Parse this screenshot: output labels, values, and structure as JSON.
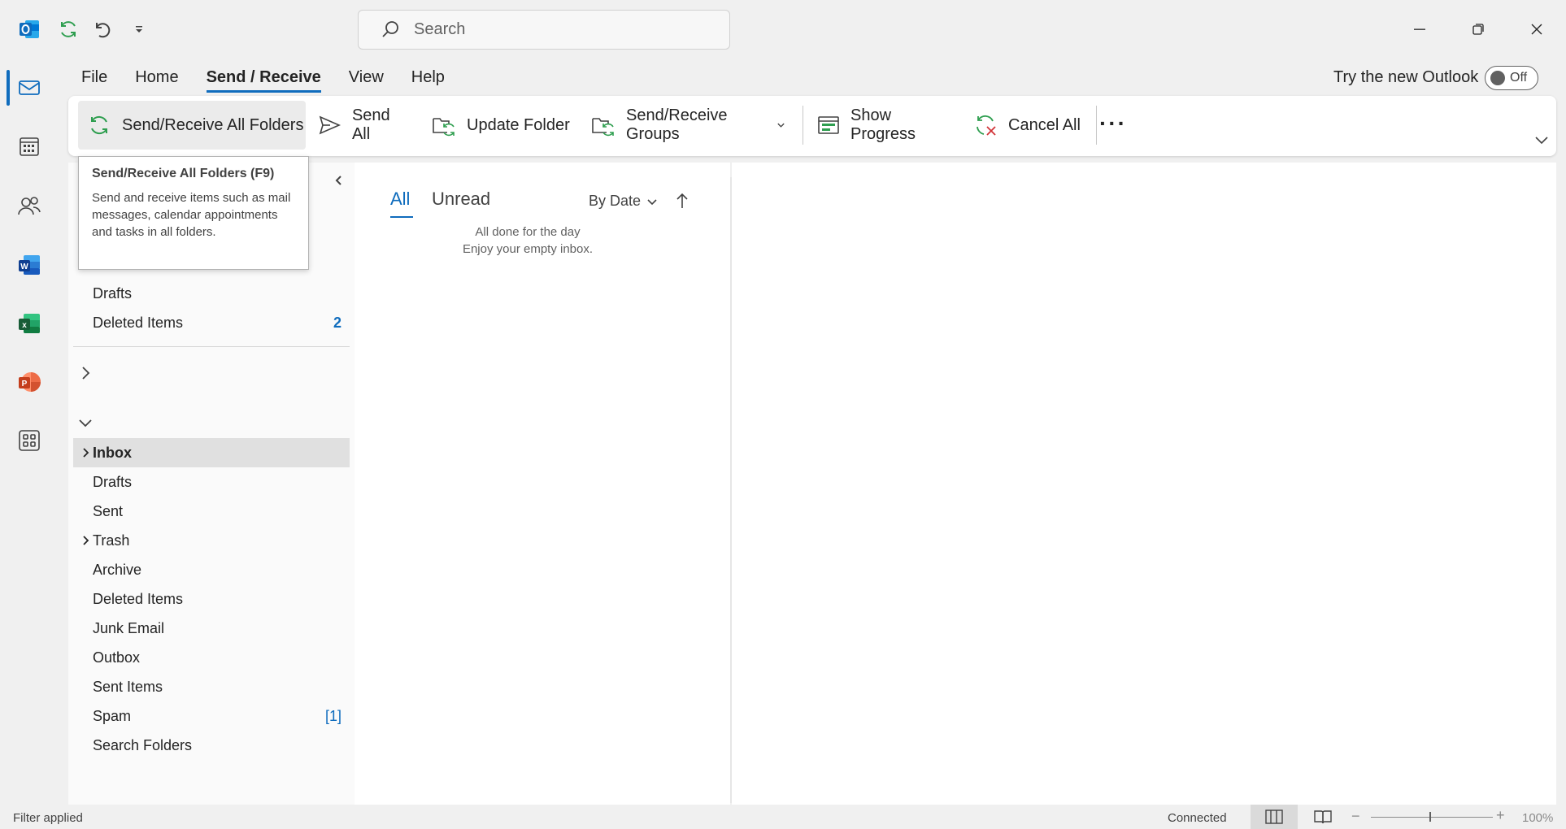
{
  "window": {
    "search_placeholder": "Search",
    "icons": [
      "outlook-icon",
      "sync-icon",
      "undo-icon",
      "customize-qat-icon",
      "minimize-icon",
      "restore-icon",
      "close-icon"
    ]
  },
  "menu": {
    "tabs": [
      {
        "label": "File"
      },
      {
        "label": "Home"
      },
      {
        "label": "Send / Receive",
        "active": true
      },
      {
        "label": "View"
      },
      {
        "label": "Help"
      }
    ],
    "try_new": "Try the new Outlook",
    "toggle_label": "Off"
  },
  "ribbon": {
    "send_receive_all": "Send/Receive All Folders",
    "send_all": "Send All",
    "update_folder": "Update Folder",
    "groups": "Send/Receive Groups",
    "show_progress": "Show Progress",
    "cancel_all": "Cancel All",
    "more": "···"
  },
  "tooltip": {
    "title": "Send/Receive All Folders (F9)",
    "body": "Send and receive items such as mail messages, calendar appointments and tasks in all folders."
  },
  "folders": {
    "top": [
      {
        "name": "Drafts",
        "count": ""
      },
      {
        "name": "Deleted Items",
        "count": "2"
      }
    ],
    "account": [
      {
        "name": "Inbox",
        "selected": true,
        "expandable": true
      },
      {
        "name": "Drafts"
      },
      {
        "name": "Sent"
      },
      {
        "name": "Trash",
        "expandable": true
      },
      {
        "name": "Archive"
      },
      {
        "name": "Deleted Items"
      },
      {
        "name": "Junk Email"
      },
      {
        "name": "Outbox"
      },
      {
        "name": "Sent Items"
      },
      {
        "name": "Spam",
        "count": "[1]"
      },
      {
        "name": "Search Folders"
      }
    ]
  },
  "messages": {
    "tab_all": "All",
    "tab_unread": "Unread",
    "sort": "By Date",
    "empty_line1": "All done for the day",
    "empty_line2": "Enjoy your empty inbox."
  },
  "status": {
    "filter": "Filter applied",
    "connection": "Connected",
    "zoom": "100%",
    "zoom_minus": "−",
    "zoom_plus": "+"
  },
  "colors": {
    "accent": "#0f6cbd",
    "background": "#f0f0f0"
  }
}
